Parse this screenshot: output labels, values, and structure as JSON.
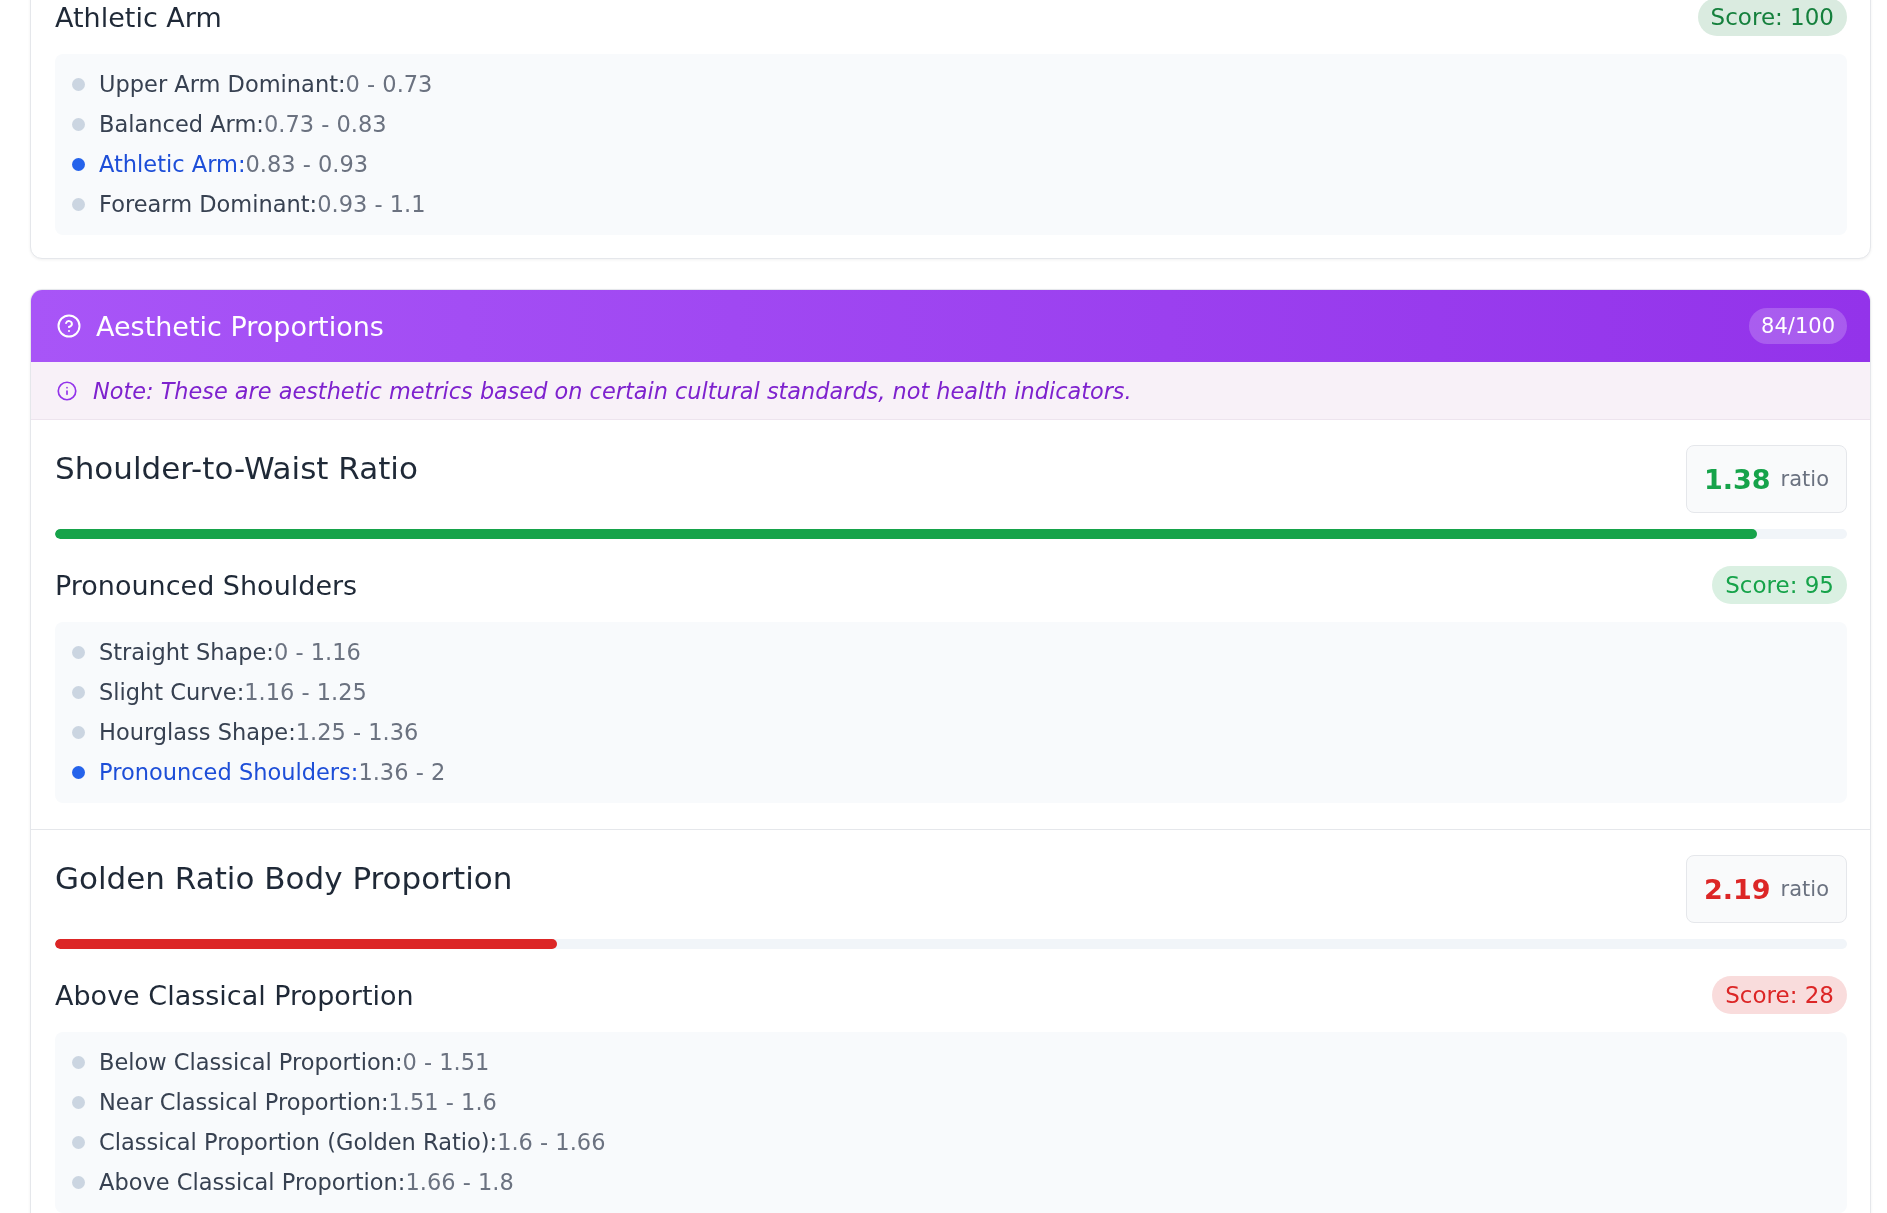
{
  "previous_section": {
    "interpretation": "Athletic Arm",
    "score": "Score: 100",
    "color": "#15803d",
    "ranges": [
      {
        "label": "Upper Arm Dominant:",
        "range": "0 - 0.73",
        "selected": false
      },
      {
        "label": "Balanced Arm:",
        "range": "0.73 - 0.83",
        "selected": false
      },
      {
        "label": "Athletic Arm:",
        "range": "0.83 - 0.93",
        "selected": true
      },
      {
        "label": "Forearm Dominant:",
        "range": "0.93 - 1.1",
        "selected": false
      }
    ]
  },
  "aesthetic_section": {
    "title": "Aesthetic Proportions",
    "score": "84/100",
    "note": "Note: These are aesthetic metrics based on certain cultural standards, not health indicators.",
    "metrics": [
      {
        "title": "Shoulder-to-Waist Ratio",
        "value": "1.38",
        "unit": "ratio",
        "color": "#16a34a",
        "level": 0.95,
        "interpretation": "Pronounced Shoulders",
        "score": "Score: 95",
        "ranges": [
          {
            "label": "Straight Shape:",
            "range": "0 - 1.16",
            "selected": false
          },
          {
            "label": "Slight Curve:",
            "range": "1.16 - 1.25",
            "selected": false
          },
          {
            "label": "Hourglass Shape:",
            "range": "1.25 - 1.36",
            "selected": false
          },
          {
            "label": "Pronounced Shoulders:",
            "range": "1.36 - 2",
            "selected": true
          }
        ]
      },
      {
        "title": "Golden Ratio Body Proportion",
        "value": "2.19",
        "unit": "ratio",
        "color": "#dc2626",
        "level": 0.28,
        "interpretation": "Above Classical Proportion",
        "score": "Score: 28",
        "ranges": [
          {
            "label": "Below Classical Proportion:",
            "range": "0 - 1.51",
            "selected": false
          },
          {
            "label": "Near Classical Proportion:",
            "range": "1.51 - 1.6",
            "selected": false
          },
          {
            "label": "Classical Proportion (Golden Ratio):",
            "range": "1.6 - 1.66",
            "selected": false
          },
          {
            "label": "Above Classical Proportion:",
            "range": "1.66 - 1.8",
            "selected": false
          }
        ]
      }
    ]
  }
}
